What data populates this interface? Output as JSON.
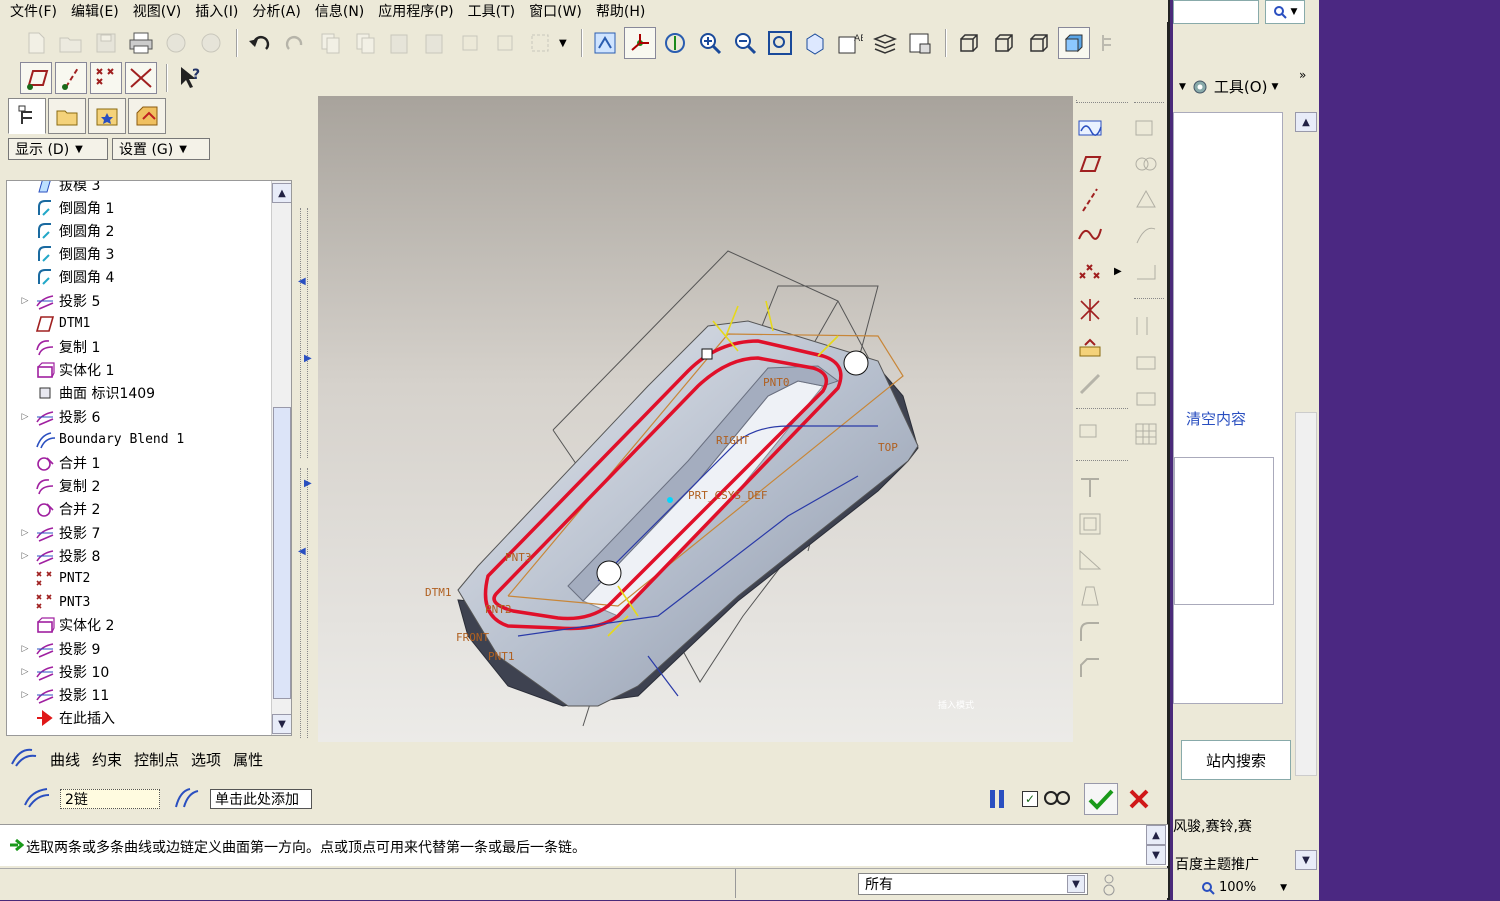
{
  "menu": [
    "文件(F)",
    "编辑(E)",
    "视图(V)",
    "插入(I)",
    "分析(A)",
    "信息(N)",
    "应用程序(P)",
    "工具(T)",
    "窗口(W)",
    "帮助(H)"
  ],
  "tree_dropdowns": {
    "display": "显示 (D)",
    "settings": "设置 (G)"
  },
  "tree_items": [
    {
      "label": "拔模 3",
      "icon": "draft-icon",
      "expander": false
    },
    {
      "label": "倒圆角 1",
      "icon": "round-icon",
      "expander": false
    },
    {
      "label": "倒圆角 2",
      "icon": "round-icon",
      "expander": false
    },
    {
      "label": "倒圆角 3",
      "icon": "round-icon",
      "expander": false
    },
    {
      "label": "倒圆角 4",
      "icon": "round-icon",
      "expander": false
    },
    {
      "label": "投影 5",
      "icon": "projection-icon",
      "expander": true
    },
    {
      "label": "DTM1",
      "icon": "datum-plane-icon",
      "expander": false,
      "mono": true
    },
    {
      "label": "复制 1",
      "icon": "copy-surface-icon",
      "expander": false
    },
    {
      "label": "实体化 1",
      "icon": "solidify-icon",
      "expander": false
    },
    {
      "label": "曲面 标识1409",
      "icon": "surface-icon",
      "expander": false
    },
    {
      "label": "投影 6",
      "icon": "projection-icon",
      "expander": true
    },
    {
      "label": "Boundary Blend 1",
      "icon": "boundary-blend-icon",
      "expander": false,
      "mono": true
    },
    {
      "label": "合并 1",
      "icon": "merge-icon",
      "expander": false
    },
    {
      "label": "复制 2",
      "icon": "copy-surface-icon",
      "expander": false
    },
    {
      "label": "合并 2",
      "icon": "merge-icon",
      "expander": false
    },
    {
      "label": "投影 7",
      "icon": "projection-icon",
      "expander": true
    },
    {
      "label": "投影 8",
      "icon": "projection-icon",
      "expander": true
    },
    {
      "label": "PNT2",
      "icon": "datum-point-icon",
      "expander": false,
      "mono": true
    },
    {
      "label": "PNT3",
      "icon": "datum-point-icon",
      "expander": false,
      "mono": true
    },
    {
      "label": "实体化 2",
      "icon": "solidify-icon",
      "expander": false
    },
    {
      "label": "投影 9",
      "icon": "projection-icon",
      "expander": true
    },
    {
      "label": "投影 10",
      "icon": "projection-icon",
      "expander": true
    },
    {
      "label": "投影 11",
      "icon": "projection-icon",
      "expander": true
    },
    {
      "label": "在此插入",
      "icon": "insert-here-arrow-icon",
      "expander": false
    }
  ],
  "dashboard": {
    "tabs": [
      "曲线",
      "约束",
      "控制点",
      "选项",
      "属性"
    ],
    "chain_count": "2链",
    "second_dir_placeholder": "单击此处添加"
  },
  "viewport": {
    "datum_labels": [
      "PNT0",
      "RIGHT",
      "TOP",
      "PRT_CSYS_DEF",
      "PNT3",
      "DTM1",
      "PNT2",
      "FRONT",
      "PNT1"
    ],
    "watermark": "插入模式"
  },
  "message": "选取两条或多条曲线或边链定义曲面第一方向。点或顶点可用来代替第一条或最后一条链。",
  "status": {
    "filter": "所有"
  },
  "side_window": {
    "tools_label": "工具(O)",
    "clear_button": "清空内容",
    "search_button": "站内搜索",
    "text1": "风骏,赛铃,赛",
    "text2": "百度主题推广",
    "zoom": "100%"
  },
  "colors": {
    "accent_red": "#e0102a",
    "ok_green": "#1a9a1a",
    "cancel_red": "#d01818",
    "purple_bg": "#4b2882"
  }
}
